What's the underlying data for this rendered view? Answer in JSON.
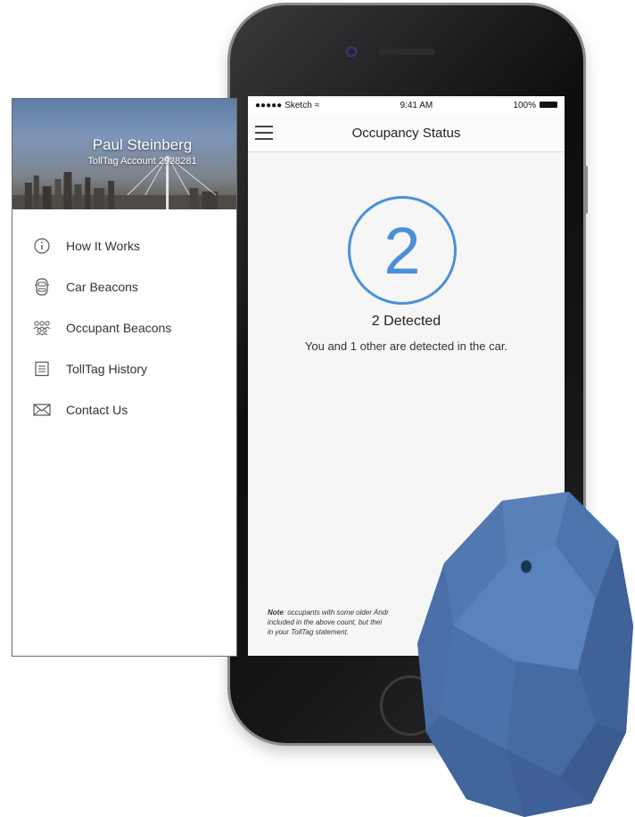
{
  "status_bar": {
    "carrier": "Sketch",
    "time": "9:41 AM",
    "battery": "100%"
  },
  "nav": {
    "title": "Occupancy Status"
  },
  "occupancy": {
    "count": "2",
    "headline": "2 Detected",
    "description": "You and 1 other are detected in the car."
  },
  "note": {
    "label": "Note",
    "text": ": occupants with some older Andr",
    "line2": "included in the above count, but thei",
    "line3": "in your TollTag statement."
  },
  "side_menu": {
    "user_name": "Paul Steinberg",
    "account": "TollTag Account 2928281",
    "items": [
      {
        "label": "How It Works",
        "icon": "info-icon"
      },
      {
        "label": "Car Beacons",
        "icon": "car-icon"
      },
      {
        "label": "Occupant Beacons",
        "icon": "people-icon"
      },
      {
        "label": "TollTag History",
        "icon": "document-icon"
      },
      {
        "label": "Contact Us",
        "icon": "envelope-icon"
      }
    ]
  },
  "colors": {
    "accent": "#4a90d9",
    "beacon": "#4a6fa8"
  }
}
